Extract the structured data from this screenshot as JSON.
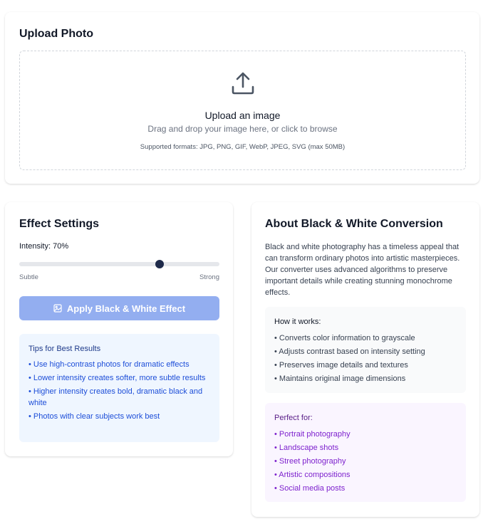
{
  "upload": {
    "title": "Upload Photo",
    "dropzone_title": "Upload an image",
    "dropzone_subtitle": "Drag and drop your image here, or click to browse",
    "formats": "Supported formats: JPG, PNG, GIF, WebP, JPEG, SVG (max 50MB)",
    "icon": "upload-icon"
  },
  "effect": {
    "title": "Effect Settings",
    "intensity_label": "Intensity: 70%",
    "intensity_value": 0.7,
    "min_label": "Subtle",
    "max_label": "Strong",
    "apply_label": "Apply Black & White Effect",
    "apply_icon": "image-icon",
    "tips_title": "Tips for Best Results",
    "tips": [
      "• Use high-contrast photos for dramatic effects",
      "• Lower intensity creates softer, more subtle results",
      "• Higher intensity creates bold, dramatic black and white",
      "• Photos with clear subjects work best"
    ]
  },
  "about": {
    "title": "About Black & White Conversion",
    "description": "Black and white photography has a timeless appeal that can transform ordinary photos into artistic masterpieces. Our converter uses advanced algorithms to preserve important details while creating stunning monochrome effects.",
    "how_title": "How it works:",
    "how_items": [
      "• Converts color information to grayscale",
      "• Adjusts contrast based on intensity setting",
      "• Preserves image details and textures",
      "• Maintains original image dimensions"
    ],
    "perfect_title": "Perfect for:",
    "perfect_items": [
      "• Portrait photography",
      "• Landscape shots",
      "• Street photography",
      "• Artistic compositions",
      "• Social media posts"
    ]
  },
  "colors": {
    "button": "#93aef0",
    "slider_thumb": "#1e2a4a",
    "tips_bg": "#eff6ff",
    "perfect_bg": "#faf5ff"
  }
}
